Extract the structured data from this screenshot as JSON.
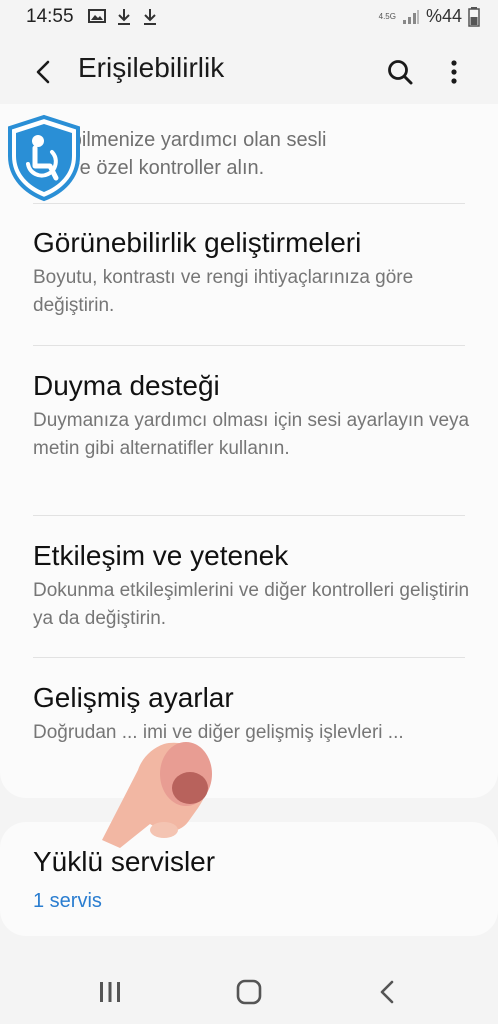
{
  "status_bar": {
    "time": "14:55",
    "network": "4.5G",
    "battery": "%44",
    "notification_icons": [
      "image-icon",
      "download-icon",
      "download-icon"
    ]
  },
  "app_bar": {
    "title": "Erişilebilirlik",
    "back_icon": "back-arrow-icon",
    "search_icon": "search-icon",
    "more_icon": "more-vert-icon"
  },
  "partial_item": {
    "line1": "...şabilmenize yardımcı olan sesli",
    "line2": "yüz ve özel kontroller alın."
  },
  "items": [
    {
      "title": "Görünebilirlik geliştirmeleri",
      "desc": "Boyutu, kontrastı ve rengi ihtiyaçlarınıza göre değiştirin."
    },
    {
      "title": "Duyma desteği",
      "desc": "Duymanıza yardımcı olması için sesi ayarlayın veya metin gibi alternatifler kullanın."
    },
    {
      "title": "Etkileşim ve yetenek",
      "desc": "Dokunma etkileşimlerini ve diğer kontrolleri geliştirin ya da değiştirin."
    },
    {
      "title": "Gelişmiş ayarlar",
      "desc": "Doğrudan ... imi ve diğer gelişmiş işlevleri ..."
    }
  ],
  "services": {
    "title": "Yüklü servisler",
    "subtitle": "1 servis"
  },
  "nav_bar": {
    "recents_icon": "recents-icon",
    "home_icon": "home-icon",
    "back_icon": "nav-back-icon"
  },
  "colors": {
    "background": "#f4f4f4",
    "card": "#fbfbfb",
    "link": "#2a7dd0",
    "badge": "#2a8fd6"
  }
}
